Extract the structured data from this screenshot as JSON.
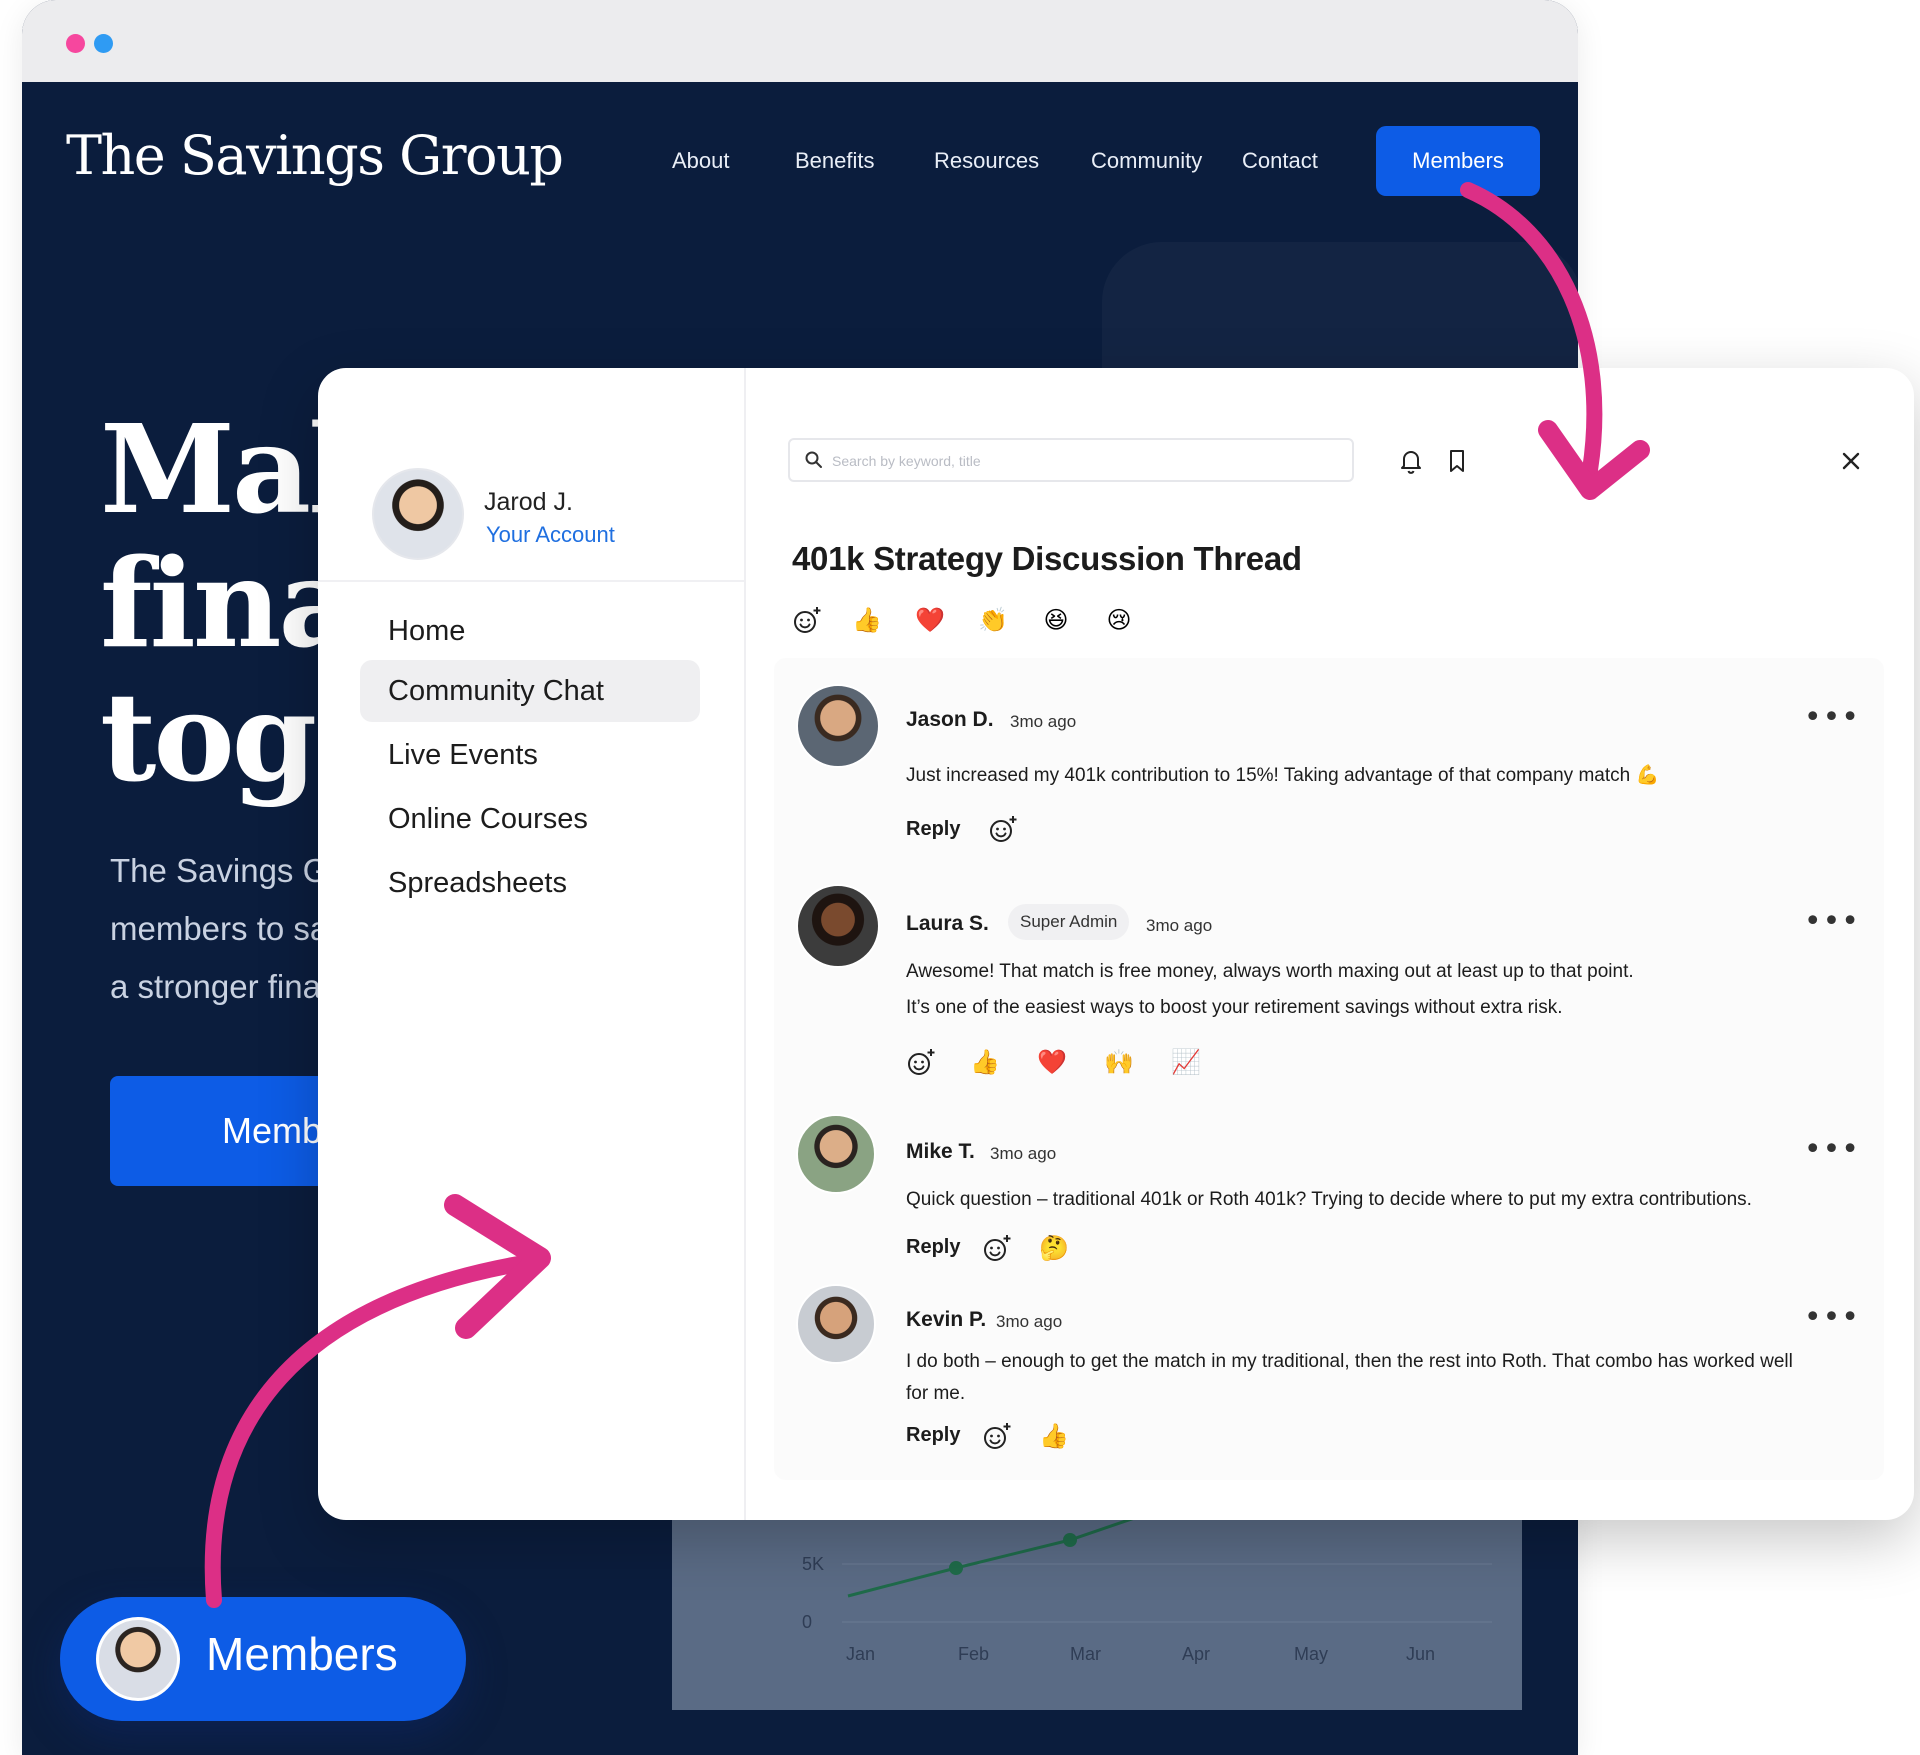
{
  "browser": {
    "dots": [
      "pink",
      "blue"
    ]
  },
  "site": {
    "logo": "The Savings Group",
    "nav": [
      "About",
      "Benefits",
      "Resources",
      "Community",
      "Contact"
    ],
    "nav_members": "Members",
    "hero_title": "Mak\nfinar\ntoge",
    "hero_text": "The Savings G\nmembers to sa\na stronger fina",
    "hero_button": "Memb"
  },
  "bg_chart": {
    "months": [
      "Jan",
      "Feb",
      "Mar",
      "Apr",
      "May",
      "Jun"
    ],
    "y_ticks": [
      "5K",
      "0"
    ]
  },
  "members_pill": {
    "label": "Members"
  },
  "modal": {
    "profile": {
      "name": "Jarod J.",
      "link": "Your Account"
    },
    "sidebar": [
      {
        "label": "Home",
        "active": false
      },
      {
        "label": "Community Chat",
        "active": true
      },
      {
        "label": "Live Events",
        "active": false
      },
      {
        "label": "Online Courses",
        "active": false
      },
      {
        "label": "Spreadsheets",
        "active": false
      }
    ],
    "search": {
      "placeholder": "Search by keyword, title",
      "value": ""
    },
    "thread_title": "401k Strategy Discussion Thread",
    "thread_reactions": [
      "👍",
      "❤️",
      "👏",
      "😆",
      "😢"
    ],
    "comments": [
      {
        "name": "Jason D.",
        "badge": "",
        "time": "3mo ago",
        "text": "Just increased my 401k contribution to 15%! Taking advantage of that company match 💪",
        "reply": "Reply",
        "reactions": []
      },
      {
        "name": "Laura S.",
        "badge": "Super Admin",
        "time": "3mo ago",
        "text": "Awesome! That match is free money, always worth maxing out at least up to that point.\nIt’s one of the easiest ways to boost your retirement savings without extra risk.",
        "reply": "",
        "reactions": [
          "👍",
          "❤️",
          "🙌",
          "📈"
        ]
      },
      {
        "name": "Mike T.",
        "badge": "",
        "time": "3mo ago",
        "text": "Quick question – traditional 401k or Roth 401k? Trying to decide where to put my extra contributions.",
        "reply": "Reply",
        "reactions": [
          "🤔"
        ]
      },
      {
        "name": "Kevin P.",
        "badge": "",
        "time": "3mo ago",
        "text": "I do both – enough to get the match in my traditional, then the rest into Roth. That combo has worked well for me.",
        "reply": "Reply",
        "reactions": [
          "👍"
        ]
      }
    ]
  },
  "colors": {
    "navy": "#0b1d3d",
    "brand_blue": "#0d5ce6",
    "arrow_pink": "#dc2f86",
    "link_blue": "#1f6fe0"
  }
}
